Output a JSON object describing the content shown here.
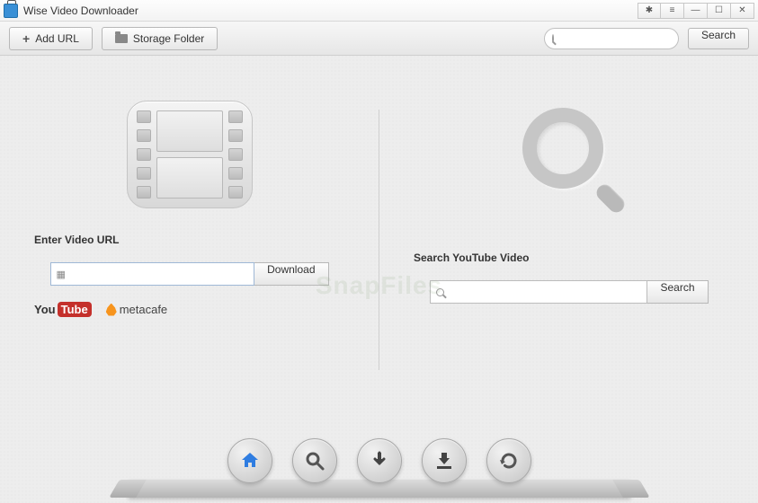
{
  "titlebar": {
    "title": "Wise Video Downloader"
  },
  "toolbar": {
    "add_url_label": "Add URL",
    "storage_folder_label": "Storage Folder",
    "search_button_label": "Search"
  },
  "main": {
    "left": {
      "label": "Enter Video URL",
      "download_label": "Download",
      "input_value": "",
      "providers": {
        "youtube_you": "You",
        "youtube_tube": "Tube",
        "metacafe": "metacafe"
      }
    },
    "right": {
      "label": "Search YouTube Video",
      "search_label": "Search",
      "input_value": ""
    }
  },
  "watermark": "SnapFiles",
  "dock": {
    "home": "home-icon",
    "search": "search-icon",
    "download": "download-icon",
    "save": "download-to-tray-icon",
    "refresh": "refresh-icon"
  }
}
